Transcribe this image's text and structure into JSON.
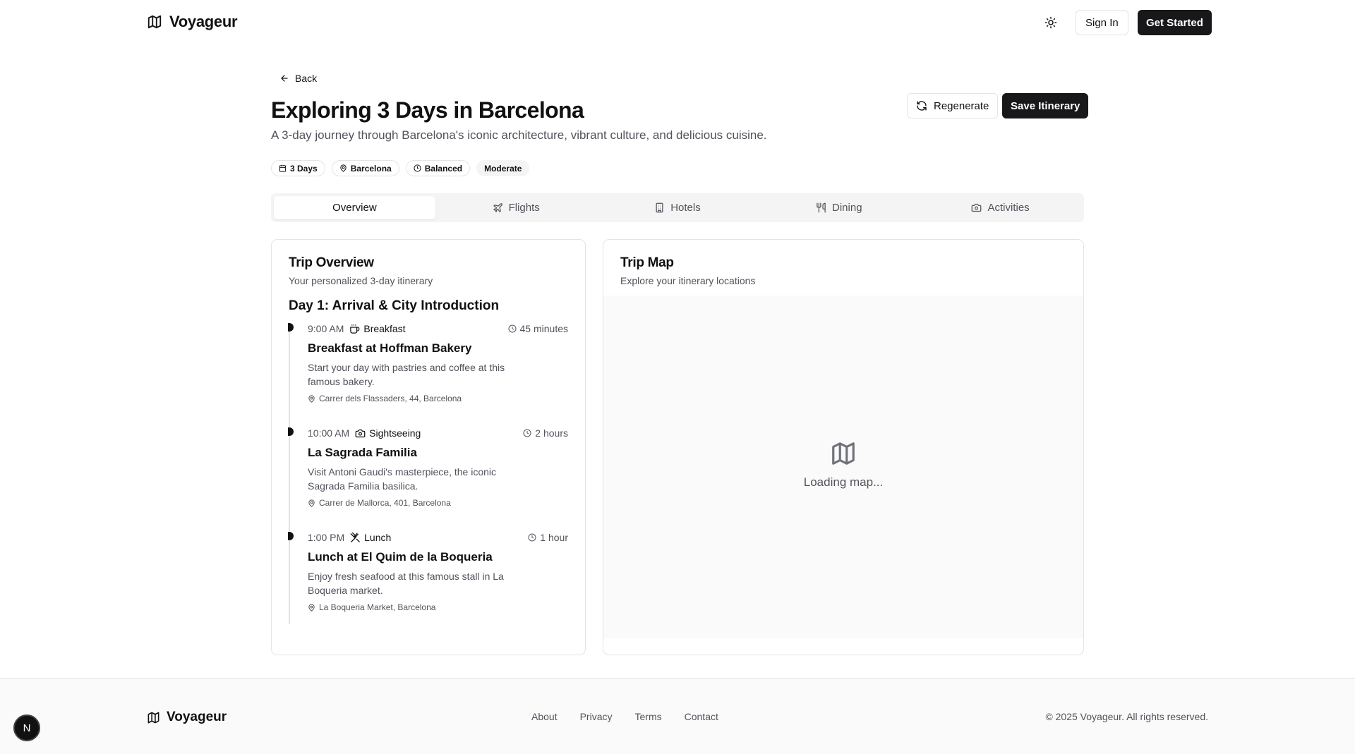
{
  "header": {
    "brand": "Voyageur",
    "sign_in": "Sign In",
    "get_started": "Get Started"
  },
  "page": {
    "back": "Back",
    "title": "Exploring 3 Days in Barcelona",
    "subtitle": "A 3-day journey through Barcelona's iconic architecture, vibrant culture, and delicious cuisine.",
    "regenerate": "Regenerate",
    "save": "Save Itinerary",
    "badges": [
      "3 Days",
      "Barcelona",
      "Balanced",
      "Moderate"
    ]
  },
  "tabs": [
    "Overview",
    "Flights",
    "Hotels",
    "Dining",
    "Activities"
  ],
  "overview": {
    "title": "Trip Overview",
    "subtitle": "Your personalized 3-day itinerary",
    "day_title": "Day 1: Arrival & City Introduction",
    "items": [
      {
        "time": "9:00 AM",
        "category": "Breakfast",
        "duration": "45 minutes",
        "name": "Breakfast at Hoffman Bakery",
        "description": "Start your day with pastries and coffee at this famous bakery.",
        "location": "Carrer dels Flassaders, 44, Barcelona"
      },
      {
        "time": "10:00 AM",
        "category": "Sightseeing",
        "duration": "2 hours",
        "name": "La Sagrada Familia",
        "description": "Visit Antoni Gaudi's masterpiece, the iconic Sagrada Familia basilica.",
        "location": "Carrer de Mallorca, 401, Barcelona"
      },
      {
        "time": "1:00 PM",
        "category": "Lunch",
        "duration": "1 hour",
        "name": "Lunch at El Quim de la Boqueria",
        "description": "Enjoy fresh seafood at this famous stall in La Boqueria market.",
        "location": "La Boqueria Market, Barcelona"
      }
    ]
  },
  "map": {
    "title": "Trip Map",
    "subtitle": "Explore your itinerary locations",
    "loading": "Loading map..."
  },
  "footer": {
    "brand": "Voyageur",
    "links": [
      "About",
      "Privacy",
      "Terms",
      "Contact"
    ],
    "copyright": "© 2025 Voyageur. All rights reserved."
  },
  "dev_badge": "N"
}
